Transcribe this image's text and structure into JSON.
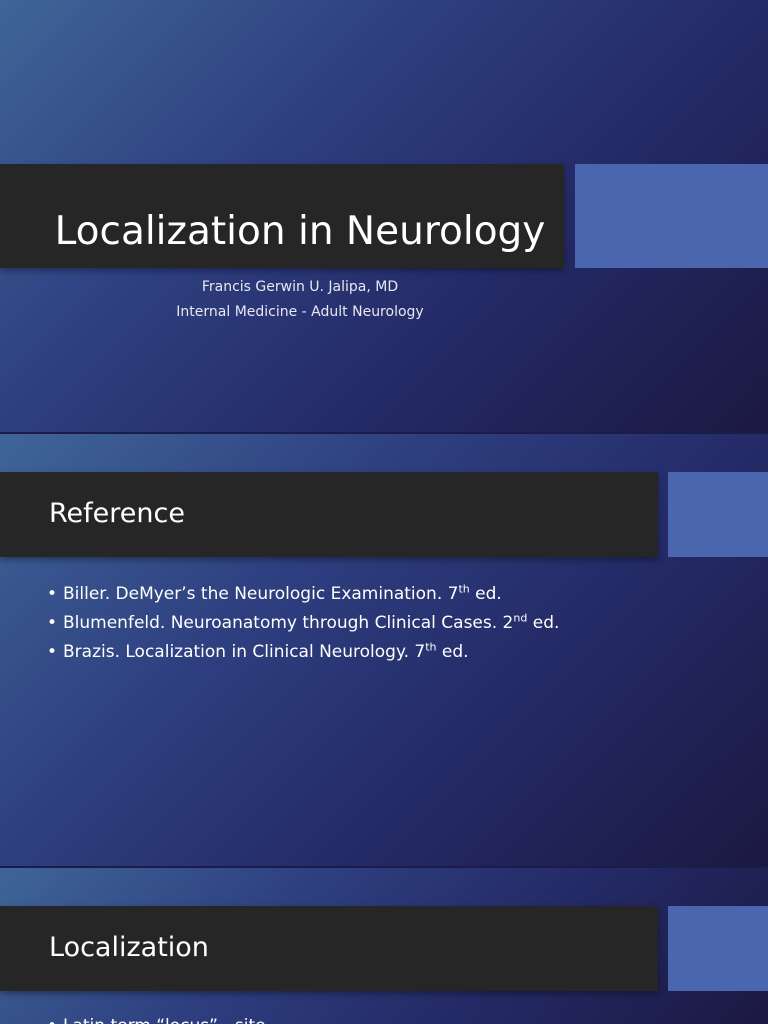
{
  "slides": [
    {
      "title": "Localization in Neurology",
      "author": "Francis Gerwin U. Jalipa, MD",
      "affiliation": "Internal Medicine - Adult Neurology"
    },
    {
      "title": "Reference",
      "references": [
        {
          "bullet": "•",
          "text": "Biller. DeMyer’s the Neurologic Examination. 7",
          "sup": "th",
          "suffix": " ed."
        },
        {
          "bullet": "•",
          "text": "Blumenfeld. Neuroanatomy through Clinical Cases. 2",
          "sup": "nd",
          "suffix": " ed."
        },
        {
          "bullet": "•",
          "text": "Brazis. Localization in Clinical Neurology. 7",
          "sup": "th",
          "suffix": " ed."
        }
      ]
    },
    {
      "title": "Localization",
      "bullets": [
        {
          "bullet": "•",
          "text": "Latin term “locus” - site"
        }
      ]
    }
  ],
  "colors": {
    "title_bar": "#262626",
    "accent": "#4a66ae",
    "gradient_light": "#3f6598",
    "gradient_dark": "#1b1942"
  }
}
